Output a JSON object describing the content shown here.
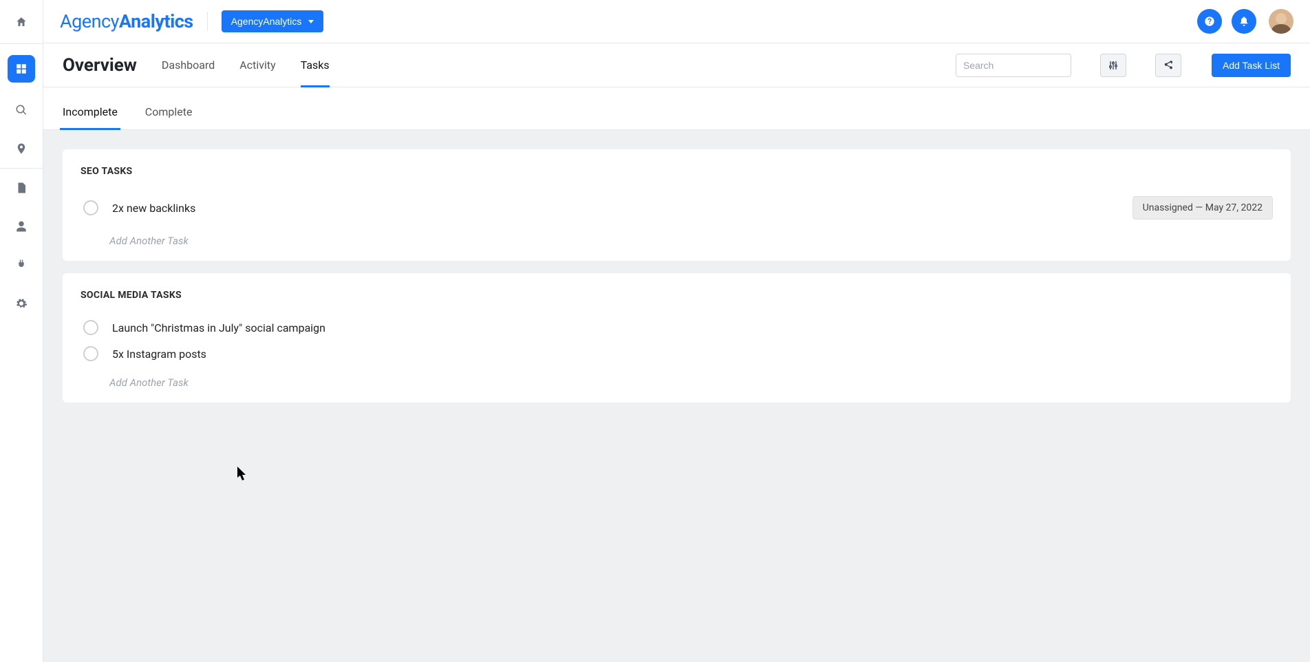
{
  "brand": {
    "part1": "Agency",
    "part2": "Analytics"
  },
  "campaign_button": "AgencyAnalytics",
  "page_title": "Overview",
  "nav_tabs": {
    "dashboard": "Dashboard",
    "activity": "Activity",
    "tasks": "Tasks"
  },
  "active_nav_tab": "tasks",
  "search": {
    "placeholder": "Search"
  },
  "add_task_list_button": "Add Task List",
  "filter_tabs": {
    "incomplete": "Incomplete",
    "complete": "Complete"
  },
  "active_filter_tab": "incomplete",
  "task_groups": [
    {
      "title": "SEO TASKS",
      "tasks": [
        {
          "label": "2x new backlinks",
          "meta": "Unassigned — May 27, 2022"
        }
      ],
      "add_label": "Add Another Task"
    },
    {
      "title": "SOCIAL MEDIA TASKS",
      "tasks": [
        {
          "label": "Launch \"Christmas in July\" social campaign",
          "meta": null
        },
        {
          "label": "5x Instagram posts",
          "meta": null
        }
      ],
      "add_label": "Add Another Task"
    }
  ]
}
